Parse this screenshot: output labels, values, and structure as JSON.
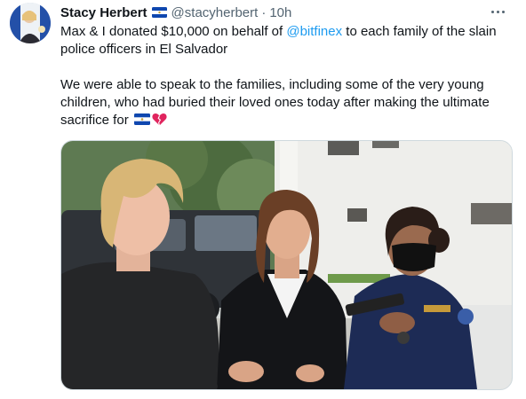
{
  "author": {
    "name": "Stacy Herbert",
    "handle": "@stacyherbert",
    "separator": "·",
    "time": "10h",
    "avatar_icon": "profile-photo-avatar",
    "flag_icon": "el-salvador-flag-icon"
  },
  "tweet": {
    "line1_prefix": "Max & I donated $10,000 on behalf of ",
    "mention": "@bitfinex",
    "line1_suffix": " to each family of the slain police officers in El Salvador",
    "para2": "We were able to speak to the families, including some of the very young children, who had buried their loved ones today after making the ultimate sacrifice for ",
    "emoji1": "el-salvador-flag-icon",
    "emoji2": "broken-heart-icon"
  },
  "more_menu": {
    "icon": "more-options-icon"
  },
  "media": {
    "kind": "photo"
  },
  "colors": {
    "text": "#0f1419",
    "secondary": "#536471",
    "link": "#1d9bf0",
    "flag_blue": "#0f47af",
    "heart_red": "#e0245e"
  }
}
